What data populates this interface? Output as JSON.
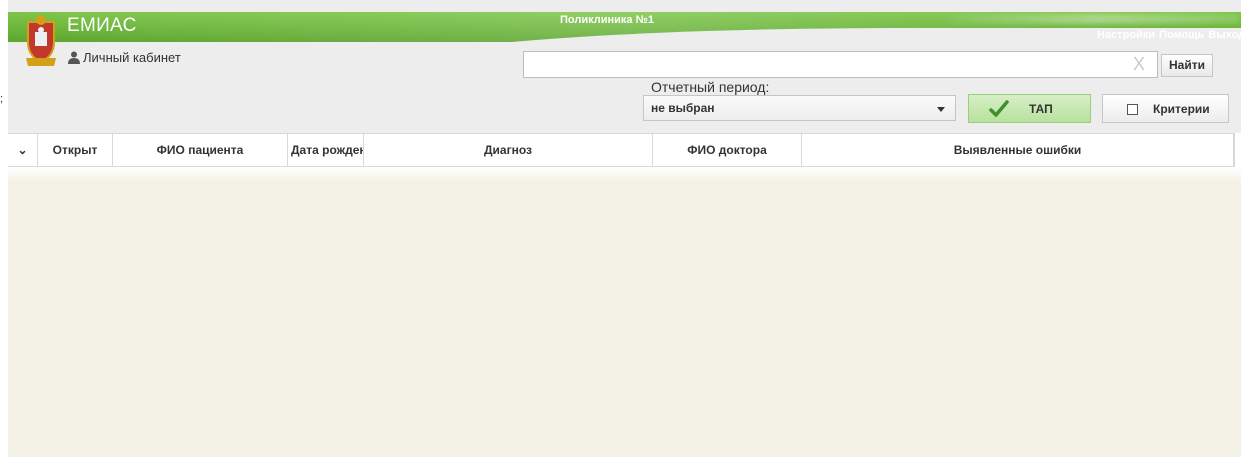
{
  "header": {
    "app_title": "ЕМИАС",
    "clinic_name": "Поликлиника №1",
    "links": [
      "Настройки",
      "Помощь",
      "Выход"
    ],
    "cabinet_label": "Личный кабинет"
  },
  "search": {
    "value": "",
    "placeholder": "",
    "find_label": "Найти",
    "clear_glyph": "X"
  },
  "filters": {
    "period_label": "Отчетный период:",
    "period_value": "не выбран",
    "tap_label": "ТАП",
    "criteria_label": "Критерии"
  },
  "grid": {
    "columns": [
      {
        "key": "expand",
        "label": "⌄"
      },
      {
        "key": "opened",
        "label": "Открыт"
      },
      {
        "key": "patient",
        "label": "ФИО пациента"
      },
      {
        "key": "birthdate",
        "label": "Дата рожден"
      },
      {
        "key": "diagnosis",
        "label": "Диагноз"
      },
      {
        "key": "doctor",
        "label": "ФИО доктора"
      },
      {
        "key": "errors",
        "label": "Выявленные ошибки"
      }
    ],
    "rows": []
  },
  "side_mark": ";",
  "colors": {
    "brand_green": "#6ab43a",
    "tap_bg": "#c8e8b2",
    "grid_bg": "#f4f2e7"
  }
}
